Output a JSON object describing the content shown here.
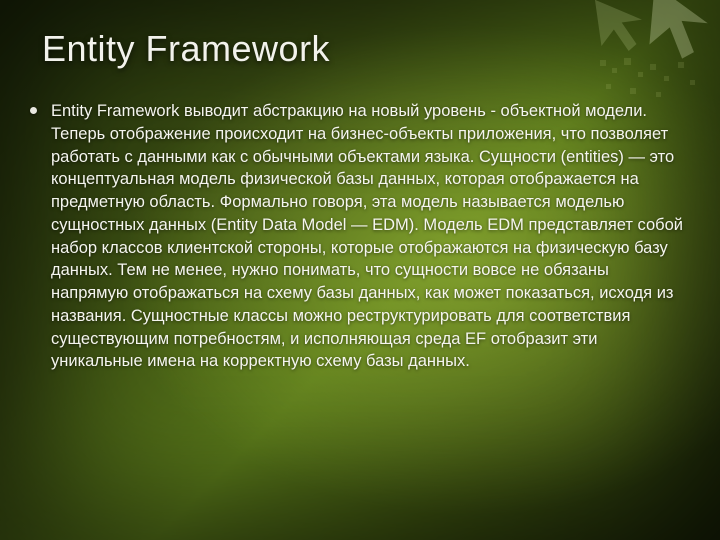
{
  "slide": {
    "title": "Entity Framework",
    "bullets": [
      "Entity Framework выводит абстракцию на новый уровень - объектной модели. Теперь отображение происходит на бизнес-объекты приложения, что позволяет работать с данными как с обычными объектами языка. Сущности (entities) — это концептуальная модель физической базы данных, которая отображается на предметную область. Формально говоря, эта модель называется моделью сущностных данных (Entity Data Model — EDM). Модель EDM представляет собой набор классов клиентской стороны, которые отображаются на физическую базу данных. Тем не менее, нужно понимать, что сущности вовсе не обязаны напрямую отображаться на схему базы данных, как может показаться, исходя из названия. Сущностные классы можно реструктурировать для соответствия существующим потребностям, и исполняющая среда EF отобразит эти уникальные имена на корректную схему базы данных."
    ]
  }
}
